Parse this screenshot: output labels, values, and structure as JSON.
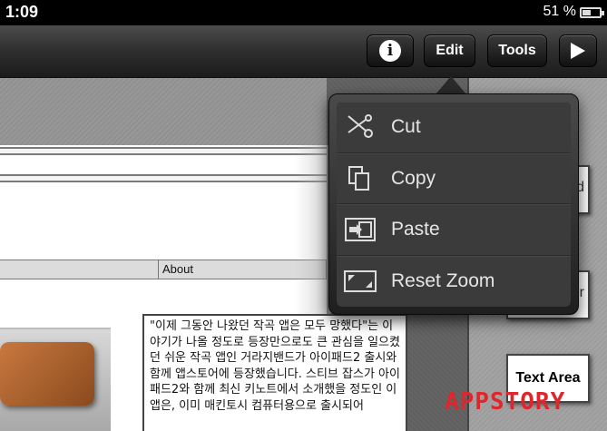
{
  "status_bar": {
    "time": "1:09",
    "battery_text": "51 %",
    "battery_level": 0.51
  },
  "toolbar": {
    "edit_label": "Edit",
    "tools_label": "Tools",
    "info_icon": "info-icon",
    "play_icon": "play-icon"
  },
  "edit_menu": {
    "items": [
      {
        "label": "Cut",
        "icon": "scissors-icon"
      },
      {
        "label": "Copy",
        "icon": "copy-icon"
      },
      {
        "label": "Paste",
        "icon": "paste-icon"
      },
      {
        "label": "Reset Zoom",
        "icon": "reset-zoom-icon"
      }
    ]
  },
  "page": {
    "nav_label": "About",
    "body_text": "\"이제 그동안 나왔던 작곡 앱은 모두 망했다\"는 이야기가 나올 정도로 등장만으로도 큰 관심을 일으켰던 쉬운 작곡 앱인 거라지밴드가 아이패드2 출시와 함께 앱스토어에 등장했습니다. 스티브 잡스가 아이패드2와 함께 최신 키노트에서 소개했을 정도인 이 앱은, 이미 매킨토시 컴퓨터용으로 출시되어"
  },
  "side_panel": {
    "item1_stub": "d",
    "item2_stub": "er",
    "item3_label": "Text Area"
  },
  "watermark": "APPSTORY",
  "colors": {
    "toolbar": "#2e2e2e",
    "menu_background": "#3b3b3b",
    "watermark": "#e0262d"
  }
}
